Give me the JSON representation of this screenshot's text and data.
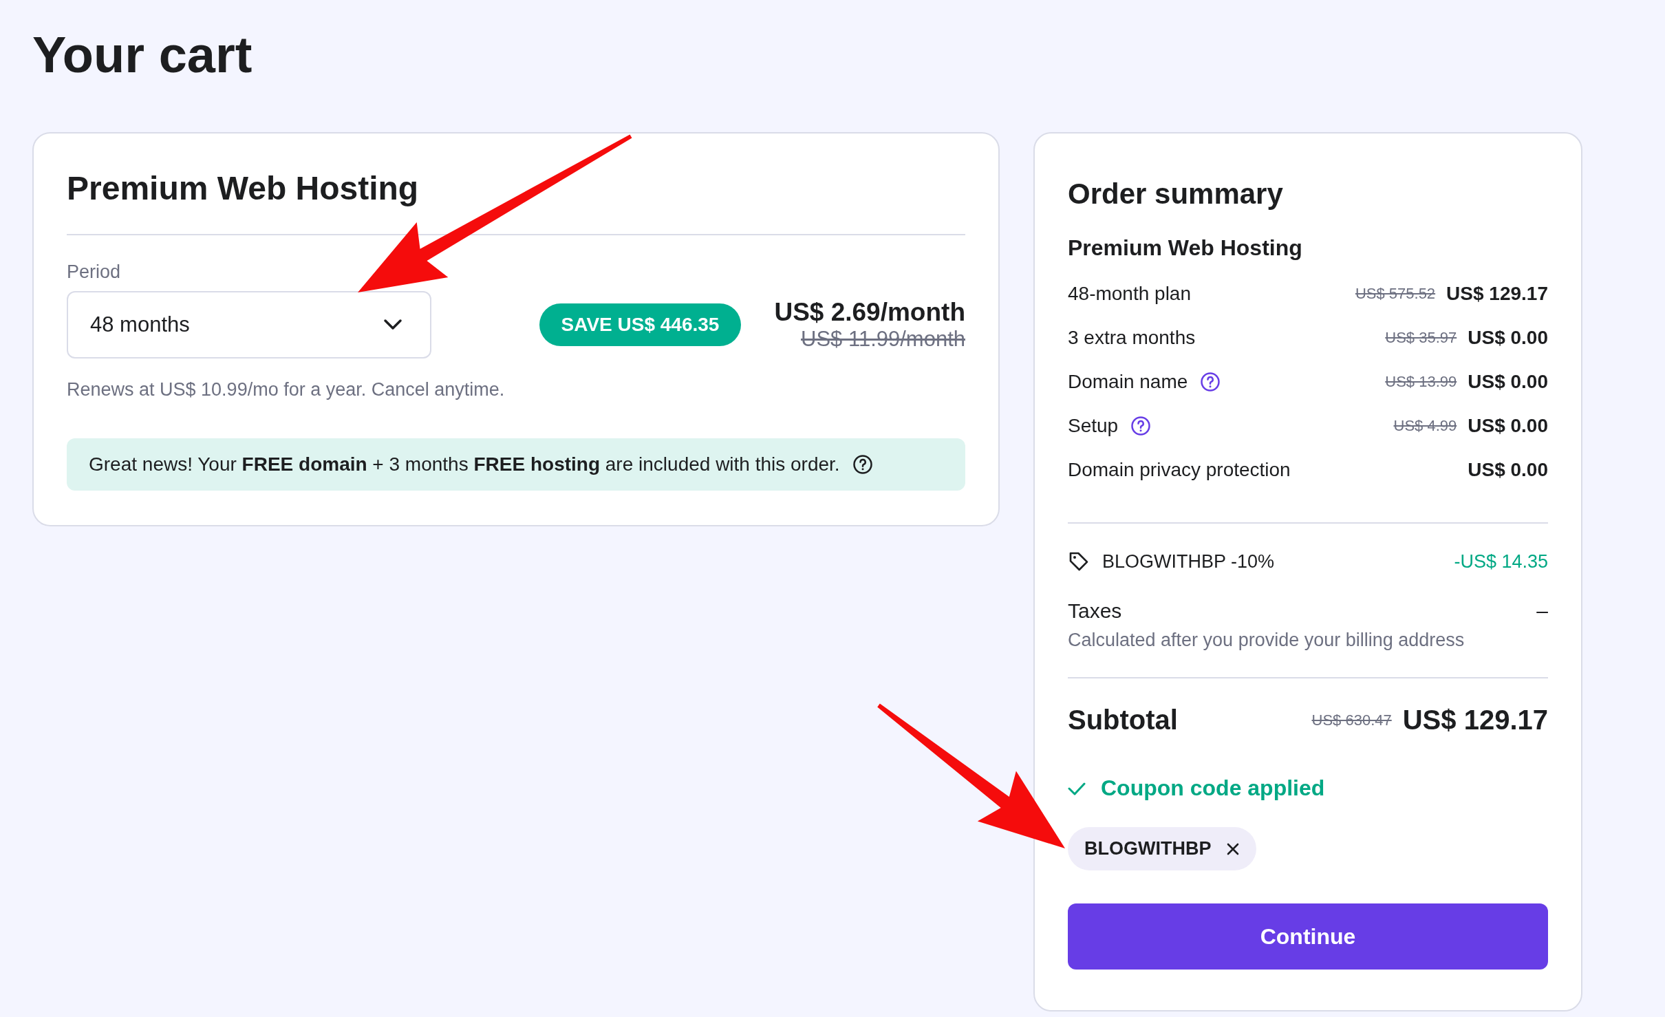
{
  "page_title": "Your cart",
  "product": {
    "title": "Premium Web Hosting",
    "period_label": "Period",
    "period_value": "48 months",
    "save_badge": "SAVE US$ 446.35",
    "price": "US$ 2.69/month",
    "old_price": "US$ 11.99/month",
    "renewal_note": "Renews at US$ 10.99/mo for a year. Cancel anytime.",
    "notice": "Great news! Your **FREE domain** + 3 months **FREE hosting** are included with this order."
  },
  "summary": {
    "title": "Order summary",
    "product_name": "Premium Web Hosting",
    "lines": [
      {
        "label": "48-month plan",
        "old_price": "US$ 575.52",
        "price": "US$ 129.17",
        "info": false
      },
      {
        "label": "3 extra months",
        "old_price": "US$ 35.97",
        "price": "US$ 0.00",
        "info": false
      },
      {
        "label": "Domain name",
        "old_price": "US$ 13.99",
        "price": "US$ 0.00",
        "info": true
      },
      {
        "label": "Setup",
        "old_price": "US$ 4.99",
        "price": "US$ 0.00",
        "info": true
      },
      {
        "label": "Domain privacy protection",
        "price": "US$ 0.00",
        "info": false
      }
    ],
    "discount": {
      "label": "BLOGWITHBP -10%",
      "amount": "-US$ 14.35"
    },
    "taxes": {
      "label": "Taxes",
      "value": "–",
      "note": "Calculated after you provide your billing address"
    },
    "subtotal": {
      "label": "Subtotal",
      "old_price": "US$ 630.47",
      "price": "US$ 129.17"
    },
    "coupon_status": "Coupon code applied",
    "coupon_chip": "BLOGWITHBP",
    "continue_button": "Continue"
  },
  "annotations": [
    {
      "kind": "arrow"
    },
    {
      "kind": "arrow"
    }
  ]
}
